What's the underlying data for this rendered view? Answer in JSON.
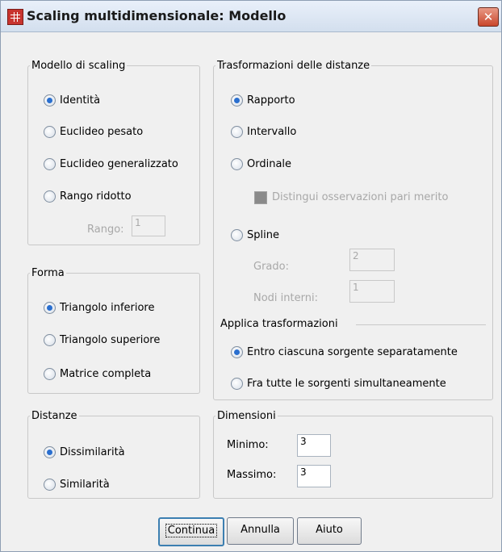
{
  "window": {
    "title": "Scaling multidimensionale: Modello",
    "close_label": "✕"
  },
  "modello": {
    "legend": "Modello di scaling",
    "options": [
      "Identità",
      "Euclideo pesato",
      "Euclideo generalizzato",
      "Rango ridotto"
    ],
    "selected": 0,
    "rango_label": "Rango:",
    "rango_value": "1"
  },
  "forma": {
    "legend": "Forma",
    "options": [
      "Triangolo inferiore",
      "Triangolo superiore",
      "Matrice completa"
    ],
    "selected": 0
  },
  "distanze": {
    "legend": "Distanze",
    "options": [
      "Dissimilarità",
      "Similarità"
    ],
    "selected": 0
  },
  "trasformazioni": {
    "legend": "Trasformazioni delle distanze",
    "options": [
      "Rapporto",
      "Intervallo",
      "Ordinale"
    ],
    "selected": 0,
    "ties_label": "Distingui osservazioni pari merito",
    "spline_label": "Spline",
    "grado_label": "Grado:",
    "grado_value": "2",
    "nodi_label": "Nodi interni:",
    "nodi_value": "1",
    "applica_label": "Applica trasformazioni",
    "applica_options": [
      "Entro ciascuna sorgente separatamente",
      "Fra tutte le sorgenti simultaneamente"
    ],
    "applica_selected": 0
  },
  "dimensioni": {
    "legend": "Dimensioni",
    "min_label": "Minimo:",
    "min_value": "3",
    "max_label": "Massimo:",
    "max_value": "3"
  },
  "buttons": {
    "continue": "Continua",
    "cancel": "Annulla",
    "help": "Aiuto"
  }
}
